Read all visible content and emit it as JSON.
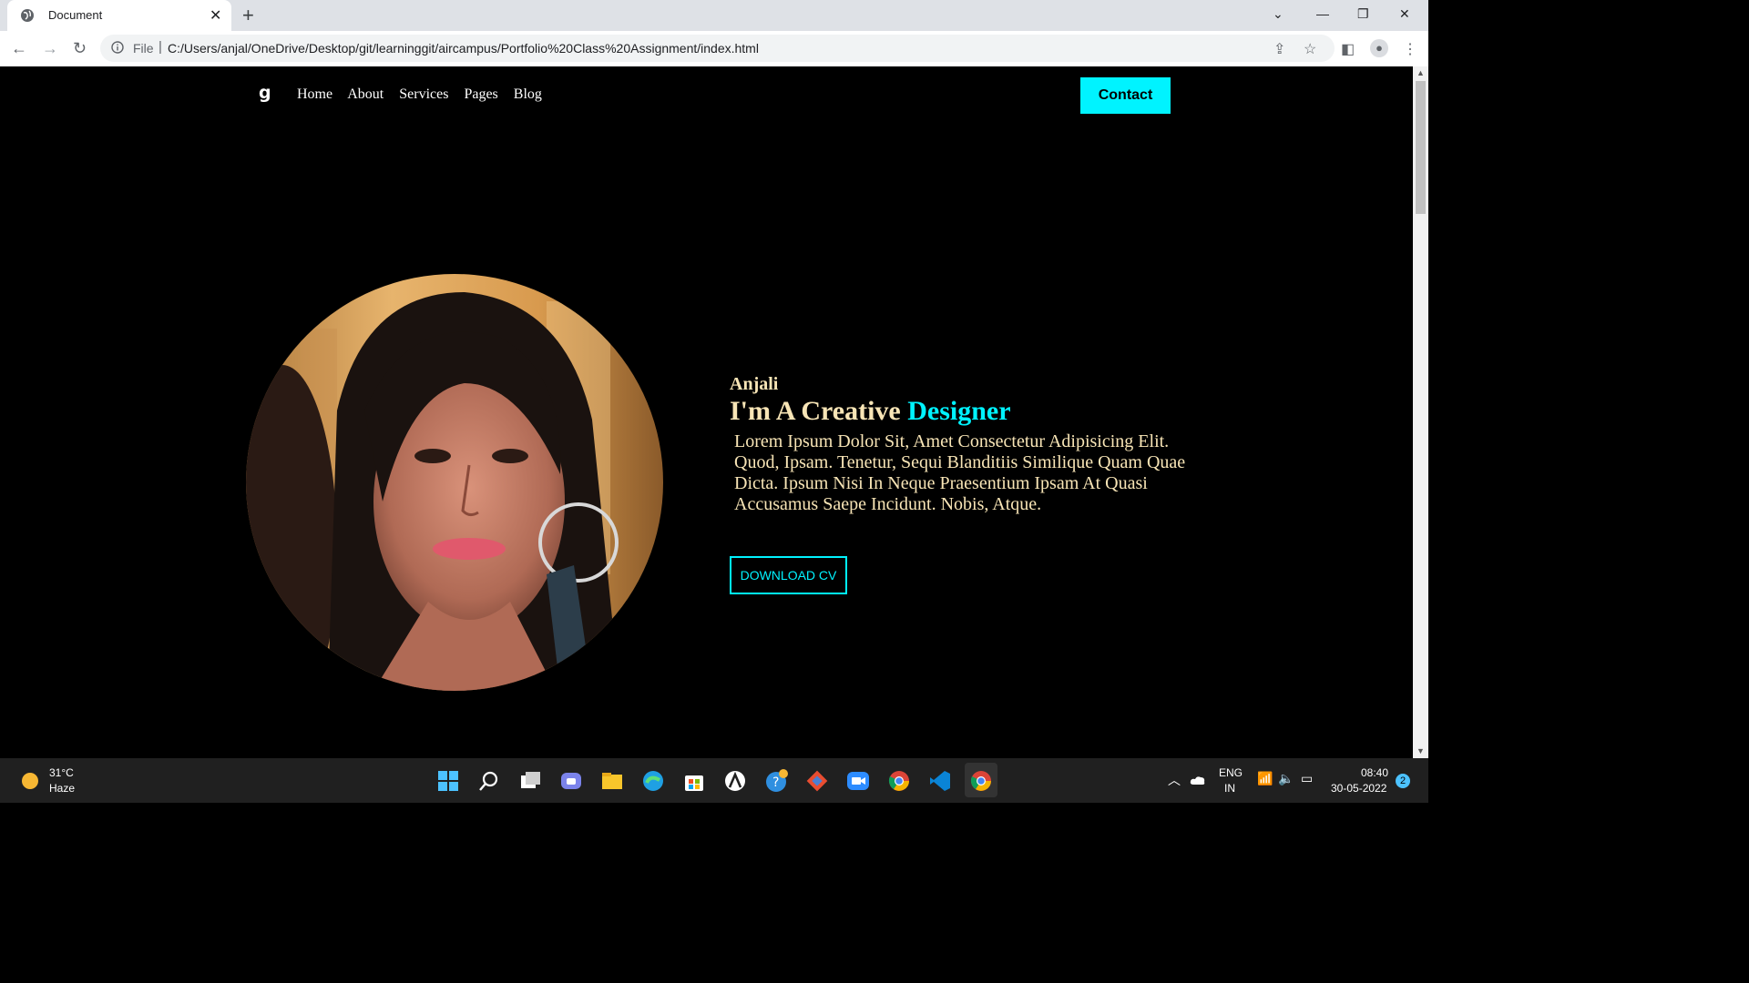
{
  "browser": {
    "tab_title": "Document",
    "tab_close": "✕",
    "new_tab": "+",
    "scheme": "File",
    "url_separator": "|",
    "url": "C:/Users/anjal/OneDrive/Desktop/git/learninggit/aircampus/Portfolio%20Class%20Assignment/index.html"
  },
  "site": {
    "logo": "g",
    "nav": [
      "Home",
      "About",
      "Services",
      "Pages",
      "Blog"
    ],
    "contact_label": "Contact",
    "hero": {
      "name": "Anjali",
      "title_prefix": "I'm A Creative ",
      "title_accent": "Designer",
      "paragraph": "Lorem Ipsum Dolor Sit, Amet Consectetur Adipisicing Elit. Quod, Ipsam. Tenetur, Sequi Blanditiis Similique Quam Quae Dicta. Ipsum Nisi In Neque Praesentium Ipsam At Quasi Accusamus Saepe Incidunt. Nobis, Atque.",
      "cta": "DOWNLOAD CV"
    },
    "colors": {
      "accent": "#00f3ff",
      "text": "#f8e5b6",
      "background": "#000000"
    }
  },
  "taskbar": {
    "temperature": "31°C",
    "weather": "Haze",
    "lang_line1": "ENG",
    "lang_line2": "IN",
    "time": "08:40",
    "date": "30-05-2022",
    "notifications": "2"
  }
}
